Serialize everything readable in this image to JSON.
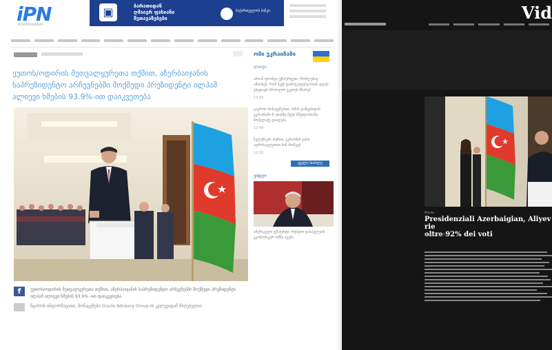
{
  "left_site": {
    "logo": "iPN",
    "logo_sub": "INTERPRESSNEWS",
    "banner": {
      "line1": "ბარათიდან",
      "line2": "ღმაიერ ფასიანი",
      "line3": "შეთავაზებები",
      "brand": "საქართველოს ბანკი"
    },
    "headline": "ეუთოს/ოდირის მეთვალყურეთა თქმით, აზერბაიჯანის საპრეზიდენტო არჩევნებში მოქმედი პრეზიდენტი ილჰამ ალიევი ხმების 93.9%-ით დაიკვეთება",
    "photo_caption": "ეუთოს/ოდირის მეთვალყურეთა თქმით, აზერბაიჯანის საპრეზიდენტო არჩევნებში მოქმედი პრეზიდენტი ილჰამ ალიევი ხმების 93.9% -ით დაიკვეთება",
    "body_para": "წყაროს ინფორმაციით, მონაცემები Oracle Advisory Group-ის კვლევიდან მიღებულია",
    "sidebar": {
      "title": "ომი უკრაინაში",
      "subtitle": "ლაივი",
      "items": [
        {
          "text": "არიან ფრანგი ექსპერტები, რომლებიც ამბობენ, რომ ჩვენ დამოუკიდებლობის დღეს ვხედავთ ბრძოლის უკეთეს მხარეს",
          "time": "13:05"
        },
        {
          "text": "გაეროს მონაცემებით, ომის დაწყებიდან უკრაინაში 8 ათასზე მეტი მშვიდობიანი მოქალაქე დაიღუპა",
          "time": "12:48"
        },
        {
          "text": "ზელენსკის თქმით, უკრაინის ჯარი აღმოსავლეთით წინ მიიწევს",
          "time": "12:30"
        }
      ],
      "more_button": "ყველა სიახლე",
      "section_head": "ვიდეო",
      "after_text": "ამერიკელი ექსპერტი: რუსეთი დასავლეთს ეკონომიკურ ომში აგებს"
    }
  },
  "right_site": {
    "logo": "Vid",
    "kicker": "Mondo",
    "title": "Presidenziali Azerbaigian, Aliyev rie\noltre 92% dei voti",
    "date": "08 febbraio 2024"
  },
  "colors": {
    "ipn_blue": "#2b7be2",
    "headline_blue": "#5ea2d8",
    "flag_blue": "#1da1e0",
    "flag_red": "#e03a2c",
    "flag_green": "#3a9a3a",
    "ua_blue": "#2b6fd8",
    "ua_yellow": "#ffd200"
  }
}
